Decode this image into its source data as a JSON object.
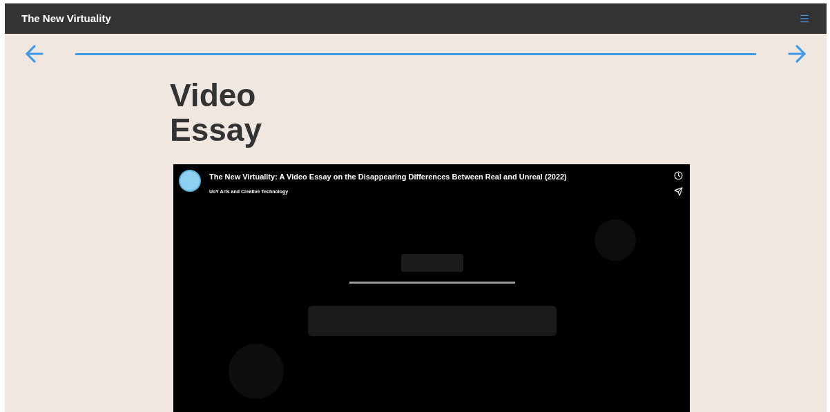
{
  "header": {
    "site_title": "The New Virtuality"
  },
  "page": {
    "heading_lines": [
      "Video",
      "Essay"
    ]
  },
  "video": {
    "kind": "picture",
    "title": "The New Virtuality: A Video Essay on the Disappearing Differences Between Real and Unreal (2022)",
    "channel": "UoY Arts and Creative Technology"
  }
}
